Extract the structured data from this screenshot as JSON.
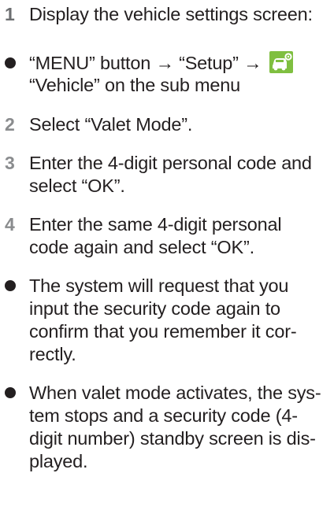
{
  "steps": [
    {
      "number": "1",
      "lines": [
        "Display the vehicle settings screen:"
      ]
    },
    {
      "number": "2",
      "lines": [
        "Select “Valet Mode”."
      ]
    },
    {
      "number": "3",
      "lines": [
        "Enter the 4-digit personal code and",
        "select “OK”."
      ]
    },
    {
      "number": "4",
      "lines": [
        "Enter the same 4-digit personal",
        "code again and select “OK”."
      ]
    }
  ],
  "menu_bullet": {
    "line1": "“MENU” button → “Setup” →",
    "line2": "“Vehicle” on the sub menu",
    "icon": "vehicle-settings-icon",
    "icon_color": "#7fbf40"
  },
  "notes": [
    {
      "lines": [
        "The system will request that you",
        "input the security code again to",
        "confirm that you remember it cor-",
        "rectly."
      ]
    },
    {
      "lines": [
        "When valet mode activates, the sys-",
        "tem stops and a security code (4-",
        "digit number) standby screen is dis-",
        "played."
      ]
    }
  ],
  "colors": {
    "text": "#231f20",
    "step_number": "#8a8c8e"
  }
}
